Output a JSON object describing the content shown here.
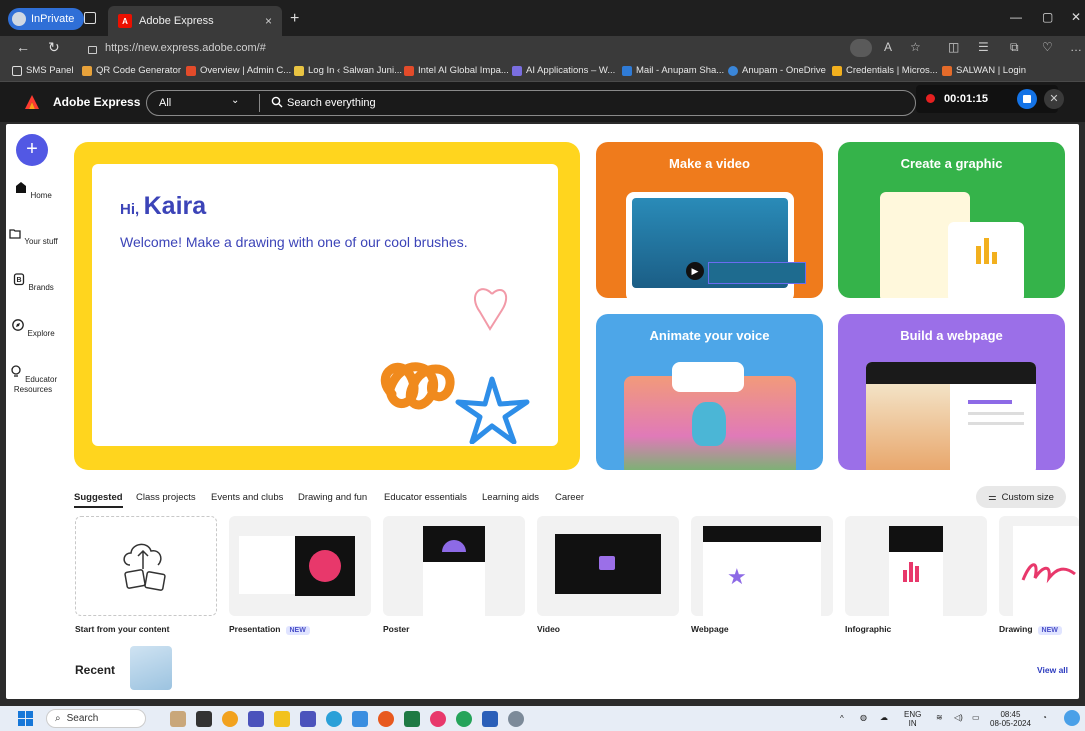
{
  "browser": {
    "inprivate_label": "InPrivate",
    "tab_title": "Adobe Express",
    "tab_close": "×",
    "new_tab": "+",
    "url": "https://new.express.adobe.com/#",
    "window_controls": [
      "—",
      "▢",
      "✕"
    ],
    "bookmarks": [
      {
        "label": "SMS Panel",
        "color": "#dddddd"
      },
      {
        "label": "QR Code Generator",
        "color": "#e8a23a"
      },
      {
        "label": "Overview | Admin C...",
        "color": "#e34b2a"
      },
      {
        "label": "Log In ‹ Salwan Juni...",
        "color": "#e9c442"
      },
      {
        "label": "Intel AI Global Impa...",
        "color": "#e34b2a"
      },
      {
        "label": "AI Applications – W...",
        "color": "#7a6ee0"
      },
      {
        "label": "Mail - Anupam Sha...",
        "color": "#2f7bd6"
      },
      {
        "label": "Anupam - OneDrive",
        "color": "#3a86d9"
      },
      {
        "label": "Credentials | Micros...",
        "color": "#f2b01e"
      },
      {
        "label": "SALWAN | Login",
        "color": "#e46b2a"
      }
    ]
  },
  "header": {
    "app_name": "Adobe Express",
    "filter_selected": "All",
    "search_placeholder": "Search everything",
    "recording_time": "00:01:15"
  },
  "sidebar": {
    "create_label": "+",
    "items": [
      {
        "label": "Home",
        "icon": "home-icon"
      },
      {
        "label": "Your stuff",
        "icon": "folder-icon"
      },
      {
        "label": "Brands",
        "icon": "brand-icon"
      },
      {
        "label": "Explore",
        "icon": "compass-icon"
      },
      {
        "label": "Educator Resources",
        "icon": "lightbulb-icon"
      }
    ]
  },
  "hero": {
    "greeting": "Hi,",
    "name": "Kaira",
    "message": "Welcome! Make a drawing with one of our cool brushes."
  },
  "quick_actions": [
    {
      "title": "Make a video",
      "color": "#ef7b1c"
    },
    {
      "title": "Create a graphic",
      "color": "#35b34a"
    },
    {
      "title": "Animate your voice",
      "color": "#4da6e8"
    },
    {
      "title": "Build a webpage",
      "color": "#9b6fe8"
    }
  ],
  "categories": {
    "tabs": [
      "Suggested",
      "Class projects",
      "Events and clubs",
      "Drawing and fun",
      "Educator essentials",
      "Learning aids",
      "Career"
    ],
    "custom_size": "Custom size"
  },
  "templates": [
    {
      "label": "Start from your content",
      "badge": ""
    },
    {
      "label": "Presentation",
      "badge": "NEW"
    },
    {
      "label": "Poster",
      "badge": ""
    },
    {
      "label": "Video",
      "badge": ""
    },
    {
      "label": "Webpage",
      "badge": ""
    },
    {
      "label": "Infographic",
      "badge": ""
    },
    {
      "label": "Drawing",
      "badge": "NEW"
    }
  ],
  "recent": {
    "title": "Recent",
    "view_all": "View all"
  },
  "taskbar": {
    "search": "Search",
    "lang": "ENG",
    "region": "IN",
    "time": "08:45",
    "date": "08-05-2024"
  }
}
